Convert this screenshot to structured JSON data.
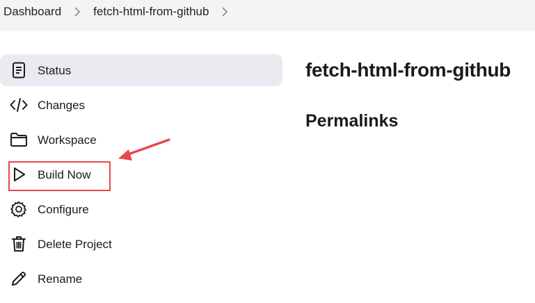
{
  "breadcrumb": {
    "items": [
      "Dashboard",
      "fetch-html-from-github"
    ]
  },
  "sidebar": {
    "items": [
      {
        "label": "Status",
        "icon": "document-icon",
        "active": true
      },
      {
        "label": "Changes",
        "icon": "code-icon"
      },
      {
        "label": "Workspace",
        "icon": "folder-icon"
      },
      {
        "label": "Build Now",
        "icon": "play-icon"
      },
      {
        "label": "Configure",
        "icon": "gear-icon"
      },
      {
        "label": "Delete Project",
        "icon": "trash-icon"
      },
      {
        "label": "Rename",
        "icon": "pencil-icon"
      }
    ]
  },
  "main": {
    "title": "fetch-html-from-github",
    "section_title": "Permalinks"
  },
  "annotation": {
    "color": "#e8474a"
  }
}
